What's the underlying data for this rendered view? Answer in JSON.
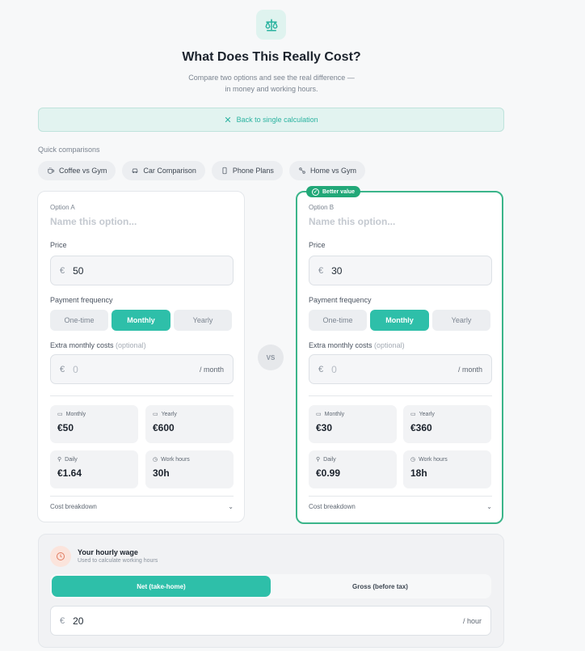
{
  "header": {
    "title": "What Does This Really Cost?",
    "subtitle_line1": "Compare two options and see the real difference —",
    "subtitle_line2": "in money and working hours.",
    "logo_icon": "scale-icon"
  },
  "back_button": {
    "label": "Back to single calculation",
    "icon": "close-icon"
  },
  "quick": {
    "label": "Quick comparisons",
    "chips": [
      {
        "label": "Coffee vs Gym",
        "icon": "coffee-cup-icon"
      },
      {
        "label": "Car Comparison",
        "icon": "car-icon"
      },
      {
        "label": "Phone Plans",
        "icon": "phone-icon"
      },
      {
        "label": "Home vs Gym",
        "icon": "dumbbell-icon"
      }
    ]
  },
  "option_a": {
    "label": "Option A",
    "name_placeholder": "Name this option...",
    "price_label": "Price",
    "currency": "€",
    "price": "50",
    "freq_label": "Payment frequency",
    "freq": [
      "One-time",
      "Monthly",
      "Yearly"
    ],
    "freq_selected": "Monthly",
    "extra_label": "Extra monthly costs",
    "extra_optional": "(optional)",
    "extra_placeholder": "0",
    "extra_suffix": "/ month",
    "stats": {
      "monthly_label": "Monthly",
      "monthly": "€50",
      "yearly_label": "Yearly",
      "yearly": "€600",
      "daily_label": "Daily",
      "daily": "€1.64",
      "work_label": "Work hours",
      "work": "30h"
    },
    "breakdown": "Cost breakdown"
  },
  "option_b": {
    "badge": "Better value",
    "label": "Option B",
    "name_placeholder": "Name this option...",
    "price_label": "Price",
    "currency": "€",
    "price": "30",
    "freq_label": "Payment frequency",
    "freq": [
      "One-time",
      "Monthly",
      "Yearly"
    ],
    "freq_selected": "Monthly",
    "extra_label": "Extra monthly costs",
    "extra_optional": "(optional)",
    "extra_placeholder": "0",
    "extra_suffix": "/ month",
    "stats": {
      "monthly_label": "Monthly",
      "monthly": "€30",
      "yearly_label": "Yearly",
      "yearly": "€360",
      "daily_label": "Daily",
      "daily": "€0.99",
      "work_label": "Work hours",
      "work": "18h"
    },
    "breakdown": "Cost breakdown"
  },
  "vs_label": "VS",
  "wage": {
    "title": "Your hourly wage",
    "subtitle": "Used to calculate working hours",
    "toggle": [
      "Net (take-home)",
      "Gross (before tax)"
    ],
    "toggle_selected": "Net (take-home)",
    "currency": "€",
    "value": "20",
    "suffix": "/ hour"
  },
  "colors": {
    "accent": "#2ebfa9",
    "better_badge": "#22a878",
    "better_border": "#3bb58a",
    "wage_icon_bg": "#fbe4dc",
    "wage_icon": "#e07a5f"
  }
}
